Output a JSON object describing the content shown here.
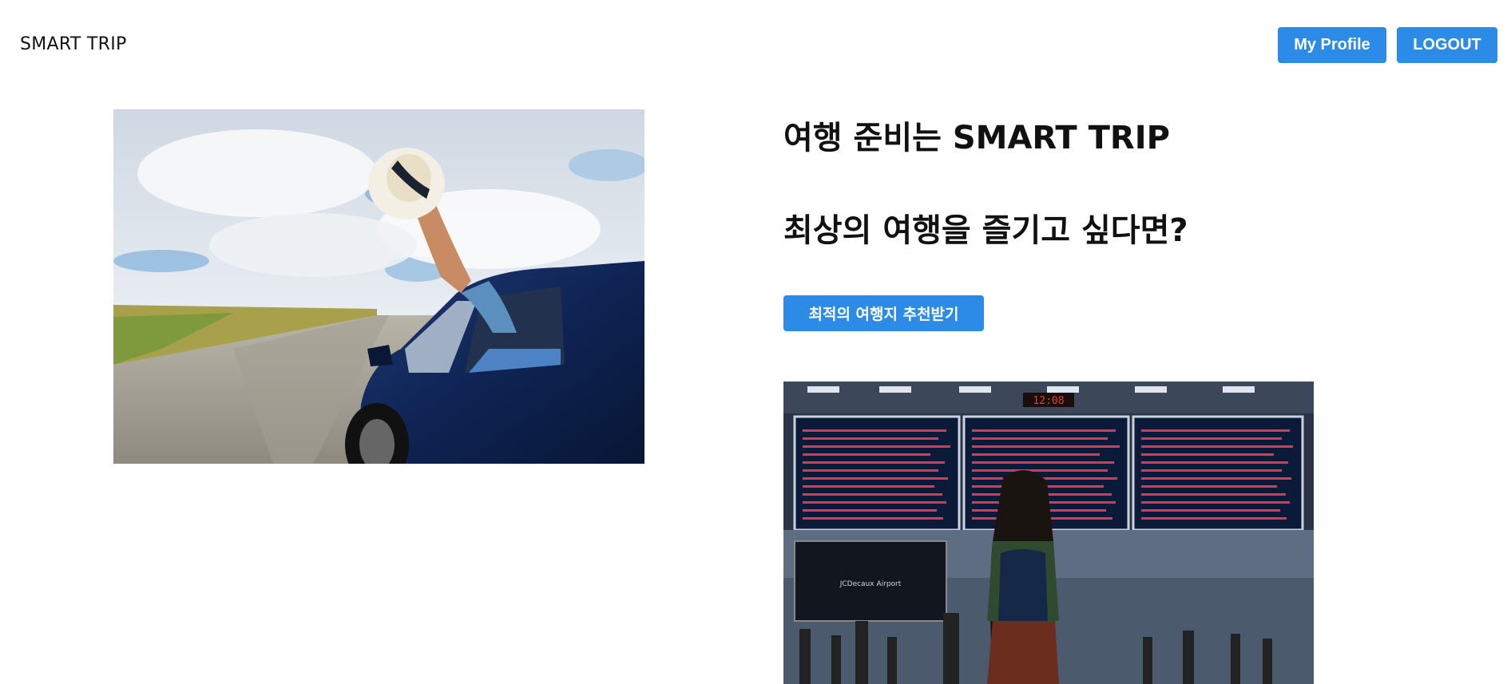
{
  "header": {
    "brand": "SMART TRIP",
    "profile_label": "My Profile",
    "logout_label": "LOGOUT"
  },
  "hero": {
    "headline_1": "여행 준비는 SMART TRIP",
    "headline_2": "최상의 여행을 즐기고 싶다면?",
    "cta_label": "최적의 여행지 추천받기"
  },
  "images": {
    "car_photo": "car-road-hat-photo",
    "airport_photo": "airport-departure-board-photo",
    "airport_sign_text": "JCDecaux Airport",
    "board_clock": "12:08"
  },
  "colors": {
    "accent": "#2b8be6",
    "text": "#111111",
    "background": "#ffffff"
  }
}
